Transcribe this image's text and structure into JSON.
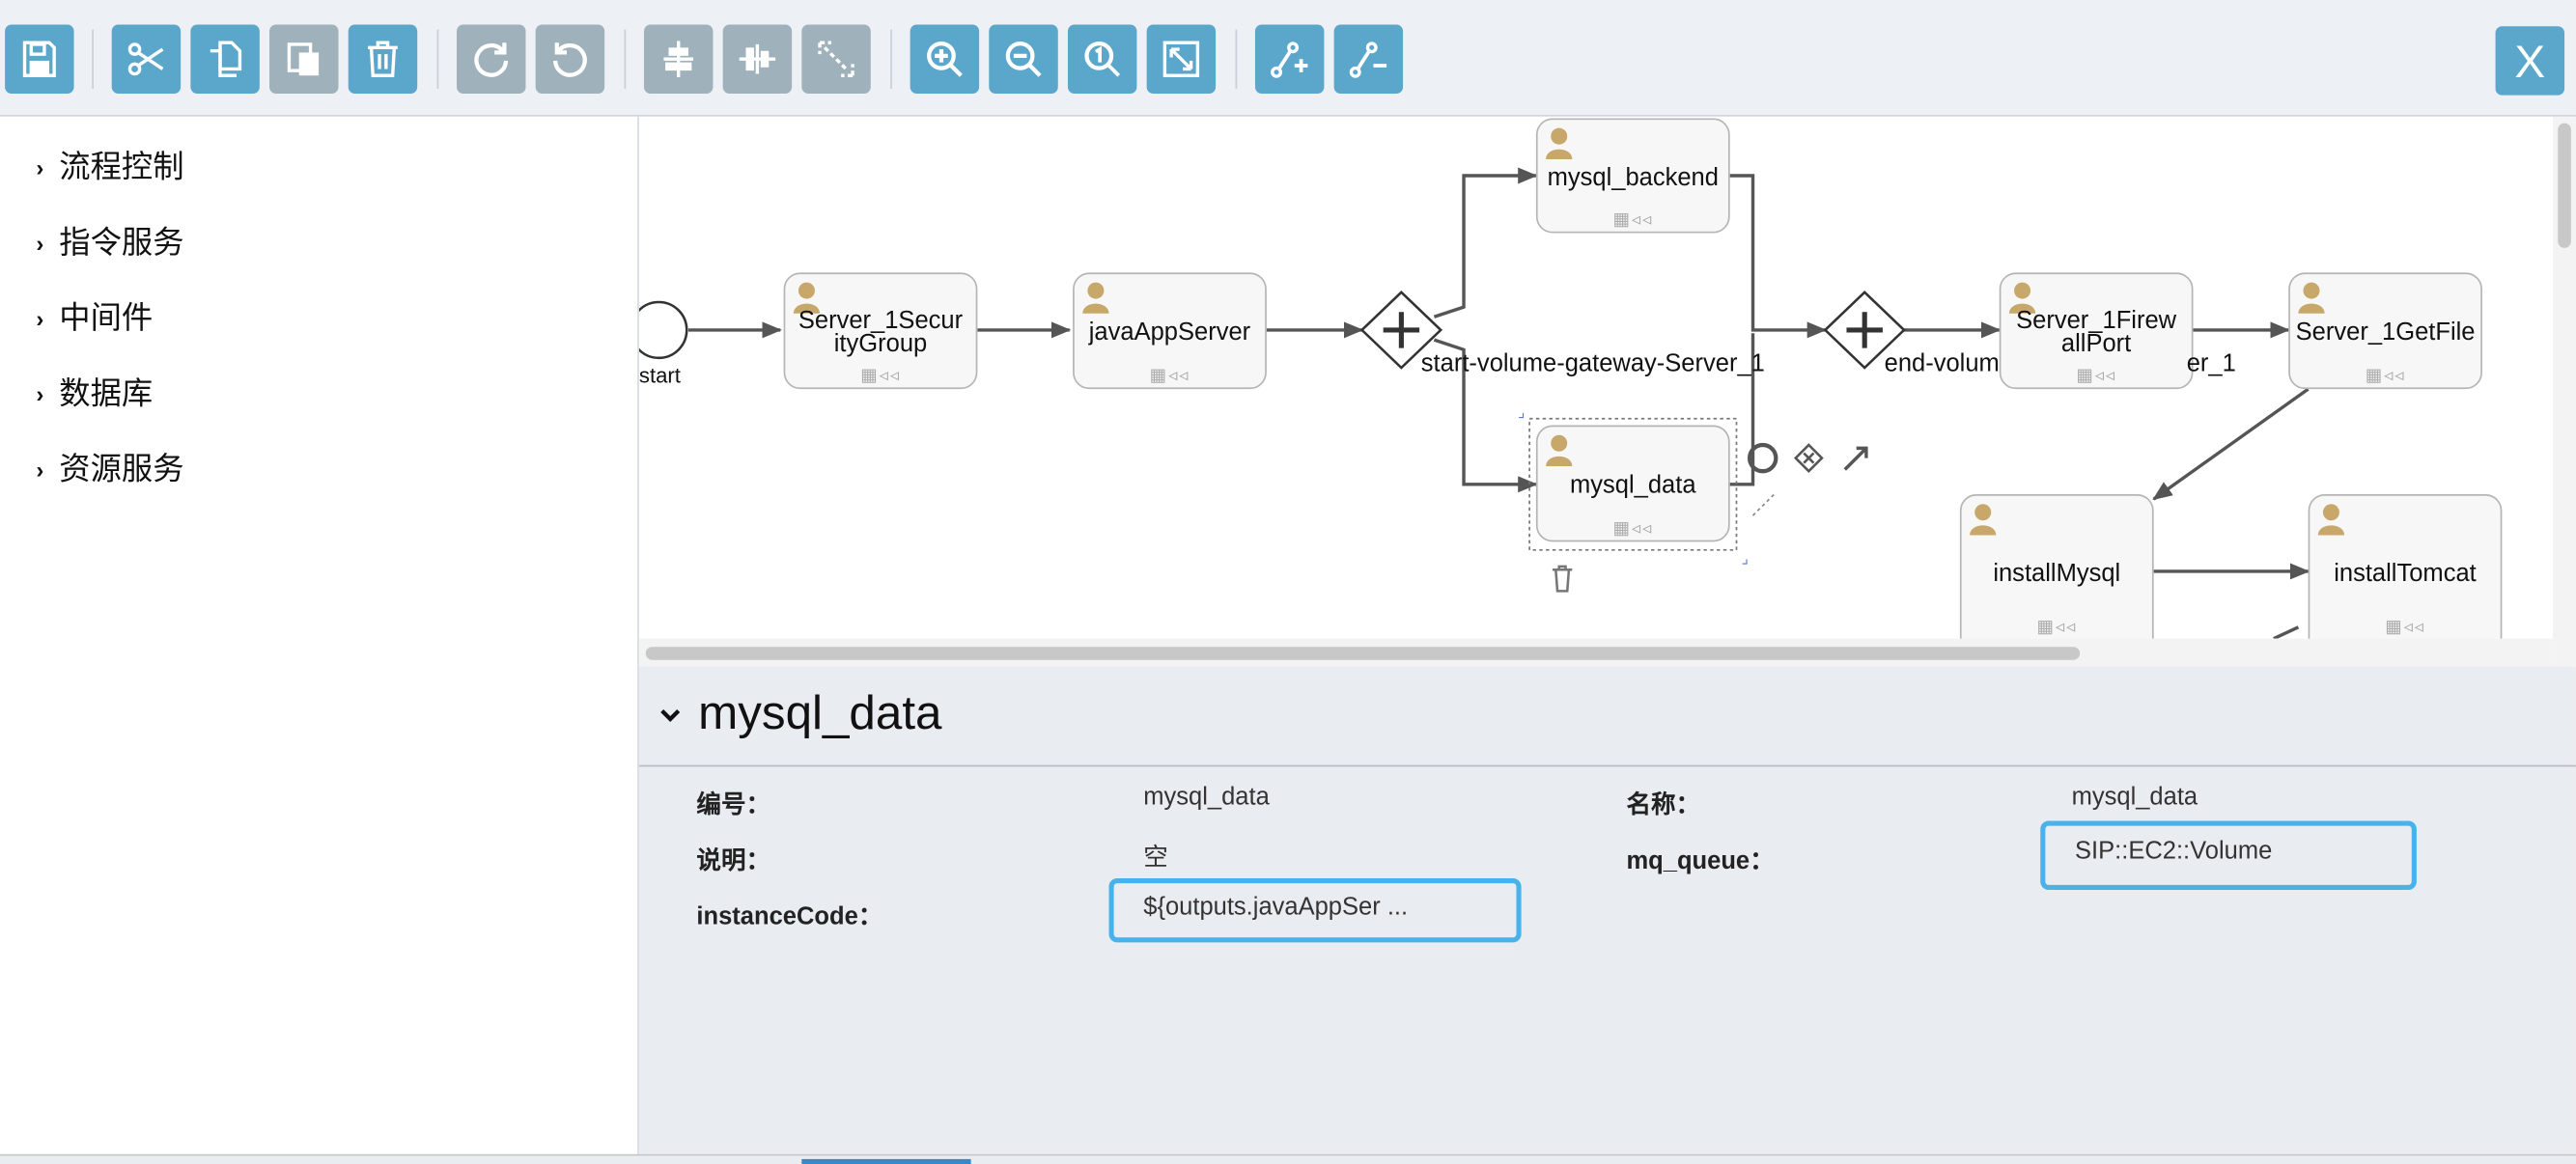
{
  "toolbar": {
    "buttons": [
      {
        "name": "save-icon"
      },
      {
        "name": "cut-icon"
      },
      {
        "name": "copy-icon"
      },
      {
        "name": "paste-icon"
      },
      {
        "name": "delete-icon"
      },
      {
        "name": "redo-icon"
      },
      {
        "name": "undo-icon"
      },
      {
        "name": "align-horizontal-icon"
      },
      {
        "name": "align-vertical-icon"
      },
      {
        "name": "same-size-icon"
      },
      {
        "name": "zoom-in-icon"
      },
      {
        "name": "zoom-out-icon"
      },
      {
        "name": "zoom-actual-icon"
      },
      {
        "name": "zoom-fit-icon"
      },
      {
        "name": "add-bendpoint-icon"
      },
      {
        "name": "remove-bendpoint-icon"
      }
    ],
    "close_label": "X",
    "accent_color": "#5ba6cb",
    "disabled_color": "#9fb1bb"
  },
  "sidebar": {
    "items": [
      {
        "label": "流程控制"
      },
      {
        "label": "指令服务"
      },
      {
        "label": "中间件"
      },
      {
        "label": "数据库"
      },
      {
        "label": "资源服务"
      }
    ]
  },
  "diagram": {
    "start_label": "start",
    "tasks": {
      "security_group": {
        "line1": "Server_1Secur",
        "line2": "ityGroup"
      },
      "java_app_server": {
        "label": "javaAppServer"
      },
      "mysql_backend": {
        "label": "mysql_backend"
      },
      "mysql_data": {
        "label": "mysql_data"
      },
      "firewall_port": {
        "line1": "Server_1Firew",
        "line2": "allPort"
      },
      "get_file": {
        "label": "Server_1GetFile"
      },
      "install_mysql": {
        "label": "installMysql"
      },
      "install_tomcat": {
        "label": "installTomcat"
      }
    },
    "gateway_labels": {
      "start_gateway": "start-volume-gateway-Server_1",
      "end_gateway_left": "end-volum",
      "end_gateway_right": "er_1"
    }
  },
  "properties": {
    "title": "mysql_data",
    "fields": {
      "id_label": "编号：",
      "id_value": "mysql_data",
      "name_label": "名称：",
      "name_value": "mysql_data",
      "desc_label": "说明：",
      "desc_value": "空",
      "mq_label": "mq_queue：",
      "mq_value": "SIP::EC2::Volume",
      "instance_label": "instanceCode：",
      "instance_value": "${outputs.javaAppSer ..."
    }
  }
}
